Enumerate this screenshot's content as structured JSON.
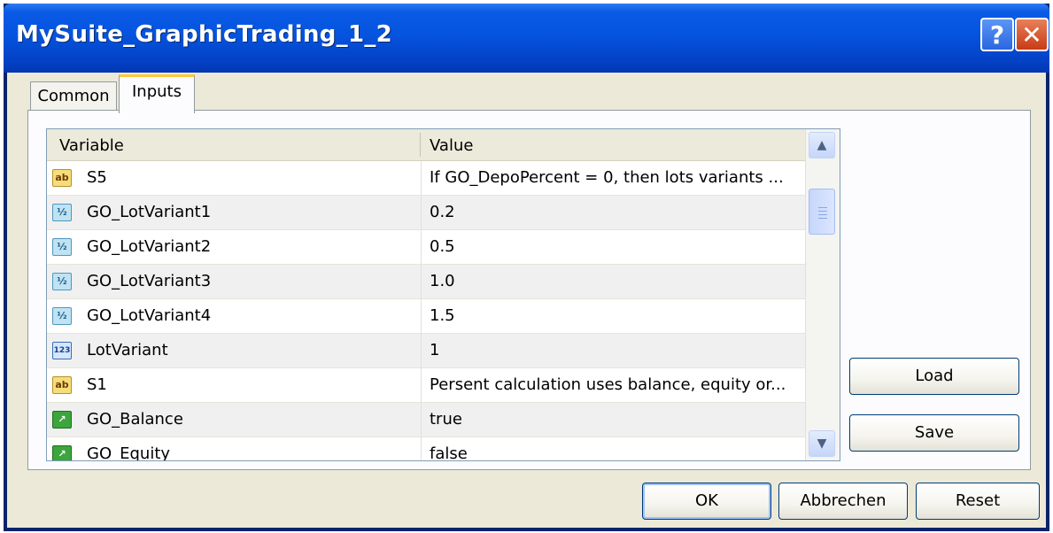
{
  "window": {
    "title": "MySuite_GraphicTrading_1_2",
    "help_button": "?",
    "close_button": "✕"
  },
  "tabs": [
    {
      "label": "Common",
      "active": false
    },
    {
      "label": "Inputs",
      "active": true
    }
  ],
  "table": {
    "columns": [
      "Variable",
      "Value"
    ],
    "rows": [
      {
        "icon": "string-icon",
        "icon_text": "ab",
        "variable": "S5",
        "value": "If GO_DepoPercent = 0, then lots variants ..."
      },
      {
        "icon": "double-icon",
        "icon_text": "½",
        "variable": "GO_LotVariant1",
        "value": "0.2"
      },
      {
        "icon": "double-icon",
        "icon_text": "½",
        "variable": "GO_LotVariant2",
        "value": "0.5"
      },
      {
        "icon": "double-icon",
        "icon_text": "½",
        "variable": "GO_LotVariant3",
        "value": "1.0"
      },
      {
        "icon": "double-icon",
        "icon_text": "½",
        "variable": "GO_LotVariant4",
        "value": "1.5"
      },
      {
        "icon": "integer-icon",
        "icon_text": "123",
        "variable": "LotVariant",
        "value": "1"
      },
      {
        "icon": "string-icon",
        "icon_text": "ab",
        "variable": "S1",
        "value": "Persent calculation uses balance, equity or..."
      },
      {
        "icon": "bool-icon",
        "icon_text": "↗",
        "variable": "GO_Balance",
        "value": "true"
      },
      {
        "icon": "bool-icon",
        "icon_text": "↗",
        "variable": "GO_Equity",
        "value": "false"
      }
    ]
  },
  "side_buttons": {
    "load": "Load",
    "save": "Save"
  },
  "footer_buttons": {
    "ok": "OK",
    "cancel": "Abbrechen",
    "reset": "Reset"
  },
  "colors": {
    "titlebar": "#0554df",
    "dialog_bg": "#ece9d8",
    "active_tab_accent": "#ffc83c"
  }
}
